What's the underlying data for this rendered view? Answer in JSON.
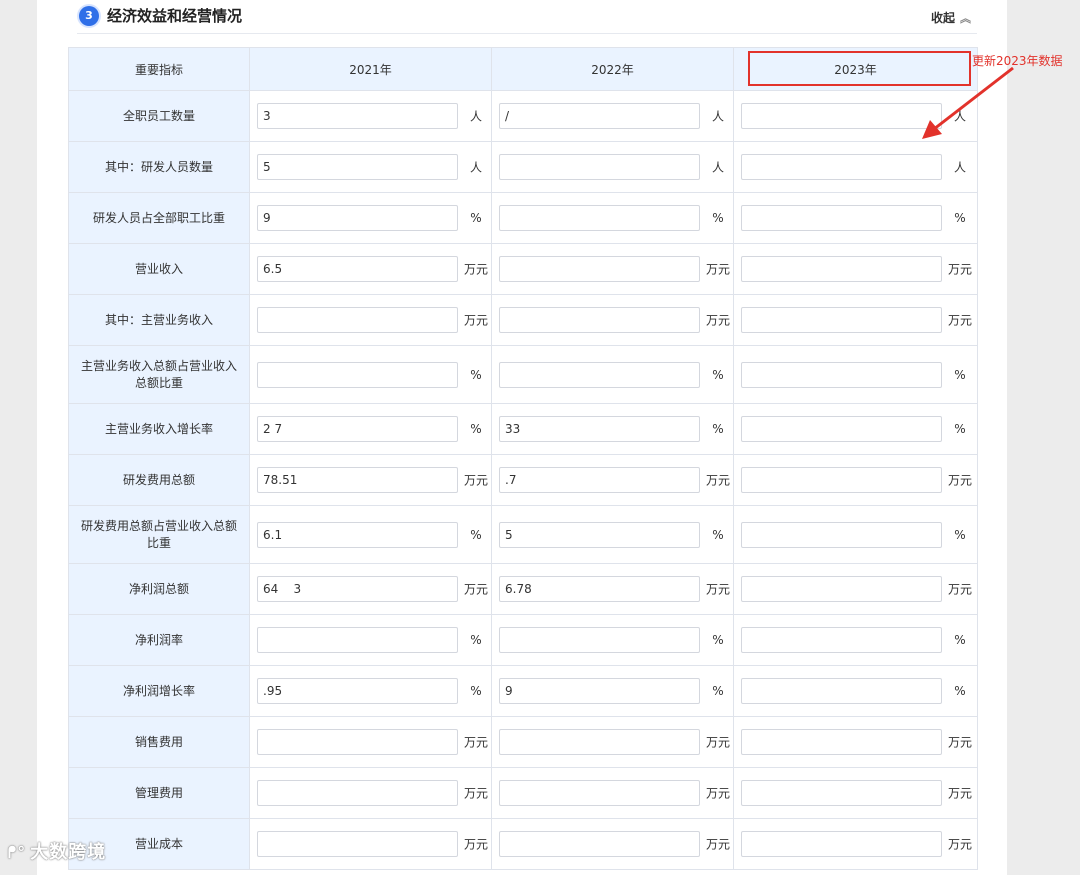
{
  "section": {
    "number": "3",
    "title": "经济效益和经营情况",
    "collapse_label": "收起"
  },
  "table": {
    "header": {
      "label": "重要指标",
      "years": [
        "2021年",
        "2022年",
        "2023年"
      ]
    },
    "rows": [
      {
        "label": "全职员工数量",
        "unit": "人",
        "values": [
          "3",
          "/",
          ""
        ]
      },
      {
        "label": "其中：研发人员数量",
        "unit": "人",
        "values": [
          "5",
          "",
          ""
        ]
      },
      {
        "label": "研发人员占全部职工比重",
        "unit": "%",
        "values": [
          "9",
          "",
          ""
        ]
      },
      {
        "label": "营业收入",
        "unit": "万元",
        "values": [
          "6.5",
          "",
          ""
        ]
      },
      {
        "label": "其中：主营业务收入",
        "unit": "万元",
        "values": [
          "",
          "",
          ""
        ]
      },
      {
        "label": "主营业务收入总额占营业收入总额比重",
        "unit": "%",
        "values": [
          "",
          "",
          ""
        ]
      },
      {
        "label": "主营业务收入增长率",
        "unit": "%",
        "values": [
          "2 7",
          "33",
          ""
        ]
      },
      {
        "label": "研发费用总额",
        "unit": "万元",
        "values": [
          "78.51",
          ".7",
          ""
        ]
      },
      {
        "label": "研发费用总额占营业收入总额比重",
        "unit": "%",
        "values": [
          "6.1",
          "5",
          ""
        ]
      },
      {
        "label": "净利润总额",
        "unit": "万元",
        "values": [
          "64    3",
          "6.78",
          ""
        ]
      },
      {
        "label": "净利润率",
        "unit": "%",
        "values": [
          "",
          "",
          ""
        ]
      },
      {
        "label": "净利润增长率",
        "unit": "%",
        "values": [
          ".95",
          "9",
          ""
        ]
      },
      {
        "label": "销售费用",
        "unit": "万元",
        "values": [
          "",
          "",
          ""
        ]
      },
      {
        "label": "管理费用",
        "unit": "万元",
        "values": [
          "",
          "",
          ""
        ]
      },
      {
        "label": "营业成本",
        "unit": "万元",
        "values": [
          "",
          "",
          ""
        ]
      }
    ]
  },
  "annotation": {
    "text": "更新2023年数据",
    "color": "#e2322b"
  },
  "watermark": {
    "text": "大数跨境"
  },
  "colors": {
    "accent": "#2f6fe8",
    "header_bg": "#eaf3ff",
    "annotation_red": "#e2322b"
  }
}
